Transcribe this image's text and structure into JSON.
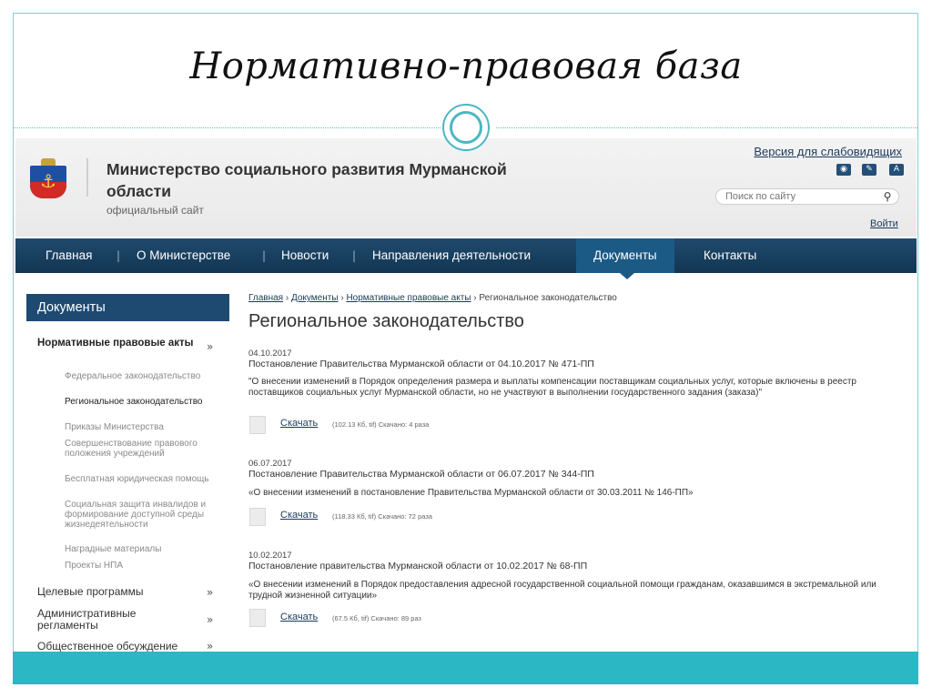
{
  "slide": {
    "title": "Нормативно-правовая база"
  },
  "site": {
    "org_name": "Министерство социального развития Мурманской области",
    "org_sub": "официальный сайт",
    "low_vision": "Версия для слабовидящих",
    "icons": [
      "rss-icon",
      "edit-icon",
      "font-size-icon"
    ],
    "icon_glyphs": [
      "◉",
      "✎",
      "A"
    ],
    "search_placeholder": "Поиск по сайту",
    "login": "Войти",
    "colors": {
      "nav": "#1d4567",
      "nav_active": "#1c5a86",
      "link": "#1b3a5c",
      "accent": "#2cb7c5"
    }
  },
  "nav": {
    "items": [
      "Главная",
      "О Министерстве",
      "Новости",
      "Направления деятельности",
      "Документы",
      "Контакты"
    ],
    "active": "Документы"
  },
  "sidebar": {
    "title": "Документы",
    "main_section": "Нормативные правовые акты",
    "sub_items": [
      "Федеральное законодательство",
      "Региональное законодательство",
      "Приказы Министерства",
      "Совершенствование правового положения учреждений",
      "Бесплатная юридическая помощь",
      "Социальная защита инвалидов и формирование доступной среды жизнедеятельности",
      "Наградные материалы",
      "Проекты НПА"
    ],
    "current_sub": "Региональное законодательство",
    "sections": [
      "Целевые программы",
      "Административные регламенты",
      "Общественное обсуждение"
    ]
  },
  "main": {
    "breadcrumb": [
      "Главная",
      "Документы",
      "Нормативные правовые акты",
      "Региональное законодательство"
    ],
    "breadcrumb_sep": "›",
    "page_title": "Региональное законодательство",
    "download_label": "Скачать",
    "documents": [
      {
        "date": "04.10.2017",
        "title": "Постановление Правительства Мурманской области от 04.10.2017 № 471-ПП",
        "description": "\"О внесении изменений в Порядок определения размера и выплаты компенсации поставщикам социальных услуг, которые включены в реестр поставщиков социальных услуг Мурманской области, но не участвуют в выполнении государственного задания (заказа)\"",
        "meta": "(102.13 Кб, tif) Скачано: 4 раза"
      },
      {
        "date": "06.07.2017",
        "title": "Постановление Правительства Мурманской области от 06.07.2017 № 344-ПП",
        "description": "«О внесении изменений в постановление Правительства Мурманской области от 30.03.2011 № 146-ПП»",
        "meta": "(118.33 Кб, tif) Скачано: 72 раза"
      },
      {
        "date": "10.02.2017",
        "title": "Постановление правительства Мурманской области от 10.02.2017 № 68-ПП",
        "description": "«О внесении изменений в Порядок предоставления адресной государственной социальной помощи гражданам, оказавшимся в экстремальной или трудной жизненной ситуации»",
        "meta": "(67.5 Кб, tif) Скачано: 89 раз"
      }
    ]
  }
}
